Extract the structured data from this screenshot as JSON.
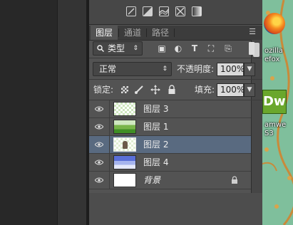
{
  "tabs": [
    {
      "label": "图层",
      "active": true
    },
    {
      "label": "通道",
      "active": false
    },
    {
      "label": "路径",
      "active": false
    }
  ],
  "tool_icons": [
    "adjust-icon-1",
    "adjust-icon-2",
    "adjust-icon-3",
    "adjust-icon-4",
    "adjust-icon-5"
  ],
  "filter": {
    "kind_label": "类型"
  },
  "blend_mode": {
    "value": "正常"
  },
  "opacity": {
    "label": "不透明度:",
    "value": "100%"
  },
  "lock": {
    "label": "锁定:"
  },
  "fill": {
    "label": "填充:",
    "value": "100%"
  },
  "layers": [
    {
      "name": "图层 3",
      "visible": true,
      "selected": false,
      "thumbnail": "transparent-checker"
    },
    {
      "name": "图层 1",
      "visible": true,
      "selected": false,
      "thumbnail": "green-grass"
    },
    {
      "name": "图层 2",
      "visible": true,
      "selected": true,
      "thumbnail": "small-figure"
    },
    {
      "name": "图层 4",
      "visible": true,
      "selected": false,
      "thumbnail": "blue-sky"
    },
    {
      "name": "背景",
      "visible": true,
      "selected": false,
      "thumbnail": "white",
      "locked": true
    }
  ],
  "desktop_icons": [
    {
      "name": "firefox",
      "label_lines": [
        "ozilla",
        "efox"
      ]
    },
    {
      "name": "dreamweaver",
      "icon_text": "Dw",
      "label_lines": [
        "amwe",
        "S3"
      ]
    }
  ],
  "colors": {
    "panel_bg": "#535353",
    "selected_row": "#596a80",
    "desktop_bg": "#7fbf9c"
  }
}
